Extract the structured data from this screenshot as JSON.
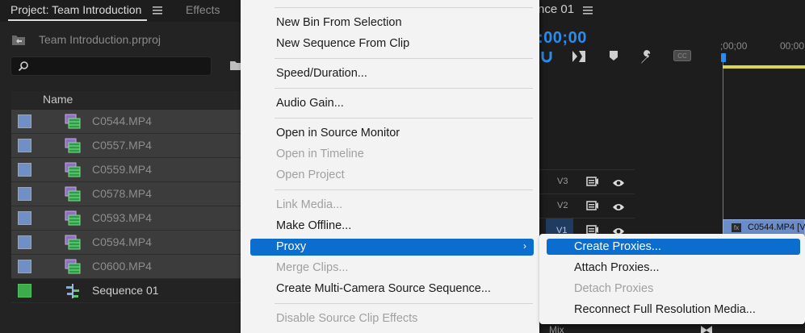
{
  "project_panel": {
    "tab_project": "Project: Team Introduction",
    "tab_effects": "Effects",
    "project_file": "Team Introduction.prproj",
    "column_name": "Name",
    "items": [
      {
        "name": "C0544.MP4",
        "type": "clip"
      },
      {
        "name": "C0557.MP4",
        "type": "clip"
      },
      {
        "name": "C0559.MP4",
        "type": "clip"
      },
      {
        "name": "C0578.MP4",
        "type": "clip"
      },
      {
        "name": "C0593.MP4",
        "type": "clip"
      },
      {
        "name": "C0594.MP4",
        "type": "clip"
      },
      {
        "name": "C0600.MP4",
        "type": "clip"
      },
      {
        "name": "Sequence 01",
        "type": "sequence"
      }
    ]
  },
  "timeline": {
    "sequence_tab": "nce 01",
    "timecode": ":00;00",
    "ruler_label_1": ";00;00",
    "ruler_label_2": "00;00",
    "tracks": [
      "V3",
      "V2",
      "V1"
    ],
    "clip_label": "C0544.MP4 [V",
    "fx_label": "fx",
    "mix_label": "Mix"
  },
  "context_menu": {
    "items": [
      {
        "label": "New Bin From Selection",
        "enabled": true
      },
      {
        "label": "New Sequence From Clip",
        "enabled": true
      },
      {
        "label": "Speed/Duration...",
        "enabled": true
      },
      {
        "label": "Audio Gain...",
        "enabled": true
      },
      {
        "label": "Open in Source Monitor",
        "enabled": true
      },
      {
        "label": "Open in Timeline",
        "enabled": false
      },
      {
        "label": "Open Project",
        "enabled": false
      },
      {
        "label": "Link Media...",
        "enabled": false
      },
      {
        "label": "Make Offline...",
        "enabled": true
      },
      {
        "label": "Proxy",
        "enabled": true,
        "highlighted": true
      },
      {
        "label": "Merge Clips...",
        "enabled": false
      },
      {
        "label": "Create Multi-Camera Source Sequence...",
        "enabled": true
      },
      {
        "label": "Disable Source Clip Effects",
        "enabled": false
      }
    ]
  },
  "proxy_submenu": {
    "items": [
      {
        "label": "Create Proxies...",
        "enabled": true,
        "highlighted": true
      },
      {
        "label": "Attach Proxies...",
        "enabled": true
      },
      {
        "label": "Detach Proxies",
        "enabled": false
      },
      {
        "label": "Reconnect Full Resolution Media...",
        "enabled": true
      }
    ]
  },
  "colors": {
    "accent_blue": "#0b6ecf",
    "timecode_blue": "#2d8ceb",
    "clip_label_color": "#6f8fc6",
    "sequence_label_color": "#3cad4a"
  }
}
